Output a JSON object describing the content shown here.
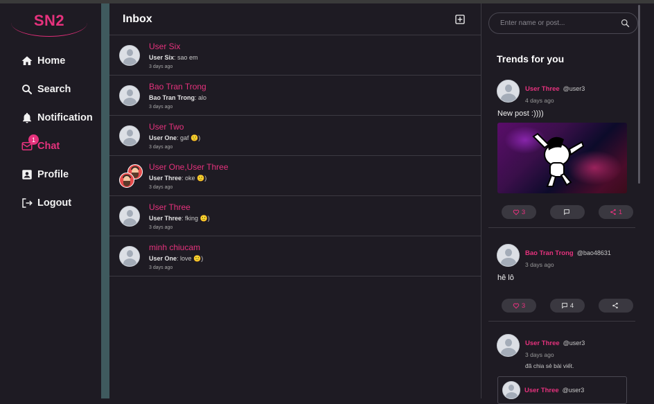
{
  "app": {
    "logo": "SN2"
  },
  "nav": {
    "items": [
      {
        "label": "Home",
        "icon": "home-icon"
      },
      {
        "label": "Search",
        "icon": "search-icon"
      },
      {
        "label": "Notification",
        "icon": "bell-icon"
      },
      {
        "label": "Chat",
        "icon": "mail-icon",
        "badge": "1",
        "active": true
      },
      {
        "label": "Profile",
        "icon": "profile-card-icon"
      },
      {
        "label": "Logout",
        "icon": "logout-icon"
      }
    ]
  },
  "inbox": {
    "title": "Inbox",
    "conversations": [
      {
        "name": "User Six",
        "sender": "User Six",
        "message": ": sao em",
        "time": "3 days ago"
      },
      {
        "name": "Bao Tran Trong",
        "sender": "Bao Tran Trong",
        "message": ": alo",
        "time": "3 days ago"
      },
      {
        "name": "User Two",
        "sender": "User One",
        "message": ": gaf 🙂)",
        "time": "3 days ago"
      },
      {
        "name": "User One,User Three",
        "sender": "User Three",
        "message": ": oke 🙂)",
        "time": "3 days ago"
      },
      {
        "name": "User Three",
        "sender": "User Three",
        "message": ": fking 🙂)",
        "time": "3 days ago"
      },
      {
        "name": "minh chiucam",
        "sender": "User One",
        "message": ": love 🙂)",
        "time": "3 days ago"
      }
    ]
  },
  "search": {
    "placeholder": "Enter name or post..."
  },
  "trends": {
    "title": "Trends for you",
    "posts": [
      {
        "name": "User Three",
        "handle": "@user3",
        "time": "4 days ago",
        "text": "New post :))))",
        "likes": "3",
        "comments": "",
        "shares": "1"
      },
      {
        "name": "Bao Tran Trong",
        "handle": "@bao48631",
        "time": "3 days ago",
        "text": "hê lô",
        "likes": "3",
        "comments": "4",
        "shares": ""
      },
      {
        "name": "User Three",
        "handle": "@user3",
        "time": "3 days ago",
        "subtext": "đã chia sẻ bài viết.",
        "shared": {
          "name": "User Three",
          "handle": "@user3"
        }
      }
    ]
  },
  "colors": {
    "accent": "#e6327d",
    "background": "#1e1b23",
    "divider": "#3c3a42",
    "sidebar_strip": "#3f5a5e"
  }
}
